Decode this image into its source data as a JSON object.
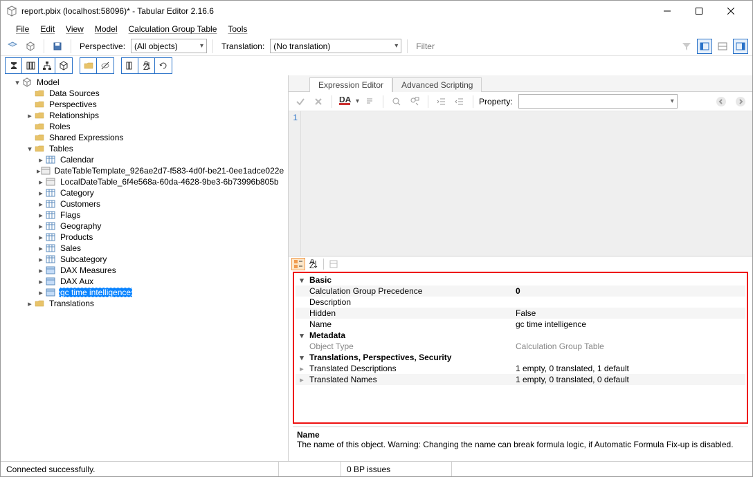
{
  "window": {
    "title": "report.pbix (localhost:58096)* - Tabular Editor 2.16.6"
  },
  "menu": {
    "file": "File",
    "edit": "Edit",
    "view": "View",
    "model": "Model",
    "calcgroup": "Calculation Group Table",
    "tools": "Tools"
  },
  "toolbar": {
    "perspective_label": "Perspective:",
    "perspective_value": "(All objects)",
    "translation_label": "Translation:",
    "translation_value": "(No translation)",
    "filter_placeholder": "Filter"
  },
  "tree": {
    "root": "Model",
    "datasources": "Data Sources",
    "perspectives": "Perspectives",
    "relationships": "Relationships",
    "roles": "Roles",
    "sharedexpr": "Shared Expressions",
    "tables": "Tables",
    "items": [
      "Calendar",
      "DateTableTemplate_926ae2d7-f583-4d0f-be21-0ee1adce022e",
      "LocalDateTable_6f4e568a-60da-4628-9be3-6b73996b805b",
      "Category",
      "Customers",
      "Flags",
      "Geography",
      "Products",
      "Sales",
      "Subcategory",
      "DAX Measures",
      "DAX Aux",
      "gc time intelligence"
    ],
    "translations": "Translations"
  },
  "tabs": {
    "expression": "Expression Editor",
    "scripting": "Advanced Scripting"
  },
  "editor": {
    "property_label": "Property:",
    "line1": "1"
  },
  "props": {
    "cat_basic": "Basic",
    "cgp_label": "Calculation Group Precedence",
    "cgp_value": "0",
    "desc_label": "Description",
    "hidden_label": "Hidden",
    "hidden_value": "False",
    "name_label": "Name",
    "name_value": "gc time intelligence",
    "cat_metadata": "Metadata",
    "objtype_label": "Object Type",
    "objtype_value": "Calculation Group Table",
    "cat_tps": "Translations, Perspectives, Security",
    "tdesc_label": "Translated Descriptions",
    "tdesc_value": "1 empty, 0 translated, 1 default",
    "tname_label": "Translated Names",
    "tname_value": "1 empty, 0 translated, 0 default"
  },
  "help": {
    "name": "Name",
    "text": "The name of this object. Warning: Changing the name can break formula logic, if Automatic Formula Fix-up is disabled."
  },
  "status": {
    "connected": "Connected successfully.",
    "bp": "0 BP issues"
  }
}
